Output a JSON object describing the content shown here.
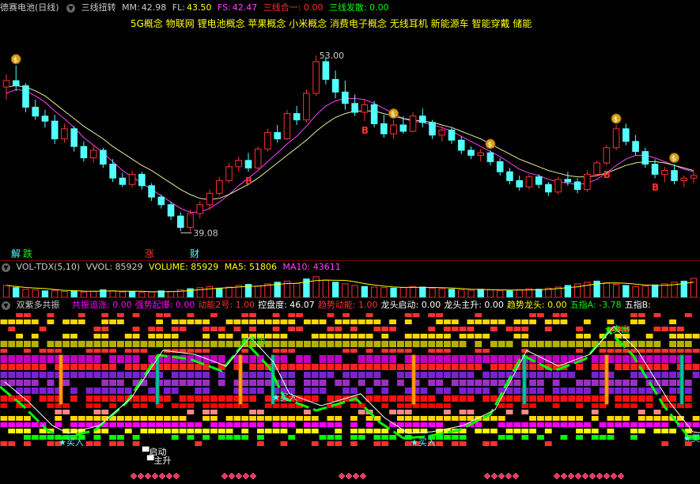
{
  "main_pane": {
    "stock_name": "德赛电池(日线)",
    "indicator": "三线扭转",
    "mm_label": "MM:",
    "mm_value": "42.98",
    "fl_label": "FL:",
    "fl_value": "43.50",
    "fs_label": "FS:",
    "fs_value": "42.47",
    "sanxian_heyi": "三线合一: 0.00",
    "sanxian_fasan": "三线发散: 0.00",
    "concepts": "5G概念 物联网 锂电池概念 苹果概念 小米概念 消费电子概念 无线耳机 新能源车 智能穿戴 储能",
    "low_label": "39.08",
    "high_label": "53.00",
    "b_label": "B",
    "markers": {
      "jie": "解",
      "die": "跌",
      "zhang": "涨",
      "cai": "财"
    }
  },
  "volume_pane": {
    "indicator": "VOL-TDX(5,10)",
    "vvol": "VVOL: 85929",
    "volume": "VOLUME: 85929",
    "ma5": "MA5: 51806",
    "ma10": "MA10: 43611"
  },
  "lower_pane": {
    "indicator": "双紫多共振",
    "items": [
      {
        "text": "共振追涨: 0.00",
        "color": "#ff00ff"
      },
      {
        "text": "强势起爆: 0.00",
        "color": "#ff00ff"
      },
      {
        "text": "动能2号: 1.00",
        "color": "#ff3030"
      },
      {
        "text": "控盘度: 46.07",
        "color": "#ffffff"
      },
      {
        "text": "趋势动能: 1.00",
        "color": "#ff3030"
      },
      {
        "text": "龙头启动: 0.00",
        "color": "#ffffff"
      },
      {
        "text": "龙头主升: 0.00",
        "color": "#ffffff"
      },
      {
        "text": "趋势龙头: 0.00",
        "color": "#ffff00"
      },
      {
        "text": "五指A: -3.78",
        "color": "#00ff00"
      },
      {
        "text": "五指B:",
        "color": "#ffffff"
      }
    ],
    "signals": {
      "sell": "卖出",
      "buy": "买入",
      "qidong": "启动",
      "zhusheng": "主升"
    }
  },
  "colors": {
    "up": "#ff3030",
    "down": "#54ffff",
    "ma_yellow": "#e8e89a",
    "ma_magenta": "#ff40ff",
    "grid_red": "#800000"
  },
  "chart_data": [
    {
      "type": "candlestick",
      "title": "德赛电池(日线)",
      "ylim": [
        38,
        55
      ],
      "candles": [
        [
          50.5,
          51.5,
          49.5,
          51.0
        ],
        [
          51.0,
          52.2,
          50.2,
          50.6
        ],
        [
          50.6,
          50.8,
          48.5,
          48.9
        ],
        [
          48.9,
          49.5,
          47.9,
          48.2
        ],
        [
          48.2,
          48.7,
          47.3,
          47.8
        ],
        [
          47.8,
          48.3,
          46.0,
          46.4
        ],
        [
          46.4,
          47.6,
          46.1,
          47.2
        ],
        [
          47.2,
          47.4,
          45.4,
          45.8
        ],
        [
          45.8,
          46.2,
          44.6,
          44.9
        ],
        [
          44.9,
          45.9,
          44.5,
          45.5
        ],
        [
          45.5,
          45.7,
          44.1,
          44.4
        ],
        [
          44.4,
          44.8,
          43.0,
          43.3
        ],
        [
          43.3,
          43.7,
          42.6,
          42.8
        ],
        [
          42.8,
          43.9,
          42.6,
          43.6
        ],
        [
          43.6,
          43.8,
          42.4,
          42.7
        ],
        [
          42.7,
          42.9,
          41.5,
          41.8
        ],
        [
          41.8,
          42.0,
          40.9,
          41.2
        ],
        [
          41.2,
          41.4,
          40.0,
          40.3
        ],
        [
          40.3,
          40.6,
          39.1,
          39.4
        ],
        [
          39.4,
          40.8,
          39.1,
          40.5
        ],
        [
          40.5,
          41.5,
          40.1,
          41.2
        ],
        [
          41.2,
          42.4,
          40.8,
          42.1
        ],
        [
          42.1,
          43.4,
          41.9,
          43.1
        ],
        [
          43.1,
          44.5,
          42.9,
          44.2
        ],
        [
          44.2,
          45.0,
          43.8,
          44.7
        ],
        [
          44.7,
          45.3,
          43.8,
          44.1
        ],
        [
          44.1,
          45.8,
          44.0,
          45.6
        ],
        [
          45.6,
          47.2,
          45.4,
          46.9
        ],
        [
          46.9,
          47.5,
          46.1,
          46.4
        ],
        [
          46.4,
          48.7,
          46.3,
          48.4
        ],
        [
          48.4,
          49.0,
          47.5,
          47.9
        ],
        [
          47.9,
          50.3,
          47.7,
          50.0
        ],
        [
          50.0,
          53.0,
          49.8,
          52.5
        ],
        [
          52.5,
          52.9,
          50.7,
          51.1
        ],
        [
          51.1,
          51.8,
          49.6,
          50.1
        ],
        [
          50.1,
          51.0,
          48.7,
          49.2
        ],
        [
          49.2,
          49.9,
          48.2,
          48.5
        ],
        [
          48.5,
          49.5,
          47.8,
          49.1
        ],
        [
          49.1,
          49.4,
          47.3,
          47.6
        ],
        [
          47.6,
          48.3,
          46.5,
          46.8
        ],
        [
          46.8,
          47.9,
          46.4,
          47.5
        ],
        [
          47.5,
          48.2,
          46.8,
          47.0
        ],
        [
          47.0,
          48.5,
          46.9,
          48.2
        ],
        [
          48.2,
          48.8,
          47.3,
          47.7
        ],
        [
          47.7,
          47.9,
          46.4,
          46.7
        ],
        [
          46.7,
          47.4,
          46.2,
          47.1
        ],
        [
          47.1,
          47.3,
          46.0,
          46.3
        ],
        [
          46.3,
          46.6,
          45.2,
          45.5
        ],
        [
          45.5,
          45.8,
          44.8,
          45.1
        ],
        [
          45.1,
          45.6,
          44.6,
          45.3
        ],
        [
          45.3,
          45.5,
          44.3,
          44.6
        ],
        [
          44.6,
          44.9,
          43.5,
          43.8
        ],
        [
          43.8,
          44.1,
          42.8,
          43.1
        ],
        [
          43.1,
          43.5,
          42.3,
          42.6
        ],
        [
          42.6,
          43.6,
          42.4,
          43.4
        ],
        [
          43.4,
          43.6,
          42.5,
          42.8
        ],
        [
          42.8,
          43.0,
          41.9,
          42.2
        ],
        [
          42.2,
          43.4,
          42.0,
          43.2
        ],
        [
          43.2,
          43.8,
          42.7,
          43.0
        ],
        [
          43.0,
          43.3,
          42.1,
          42.4
        ],
        [
          42.4,
          43.9,
          42.2,
          43.6
        ],
        [
          43.6,
          44.7,
          43.4,
          44.5
        ],
        [
          44.5,
          45.9,
          44.3,
          45.7
        ],
        [
          45.7,
          47.5,
          45.5,
          47.2
        ],
        [
          47.2,
          47.6,
          45.9,
          46.2
        ],
        [
          46.2,
          46.7,
          45.1,
          45.4
        ],
        [
          45.4,
          45.7,
          44.1,
          44.4
        ],
        [
          44.4,
          44.8,
          43.3,
          43.6
        ],
        [
          43.6,
          44.2,
          43.0,
          43.9
        ],
        [
          43.9,
          44.4,
          42.8,
          43.1
        ],
        [
          43.1,
          43.5,
          42.6,
          43.3
        ],
        [
          43.3,
          43.8,
          42.9,
          43.5
        ]
      ],
      "ma_series": [
        {
          "name": "MM",
          "values": [
            50.0,
            50.3,
            50.2,
            49.8,
            49.3,
            48.6,
            48.0,
            47.3,
            46.5,
            45.9,
            45.3,
            44.6,
            43.9,
            43.4,
            42.9,
            42.4,
            41.9,
            41.4,
            40.9,
            40.6,
            40.6,
            40.9,
            41.4,
            42.0,
            42.7,
            43.3,
            43.9,
            44.6,
            45.3,
            46.0,
            46.6,
            47.4,
            48.3,
            49.0,
            49.4,
            49.6,
            49.6,
            49.5,
            49.2,
            48.8,
            48.4,
            48.0,
            47.8,
            47.7,
            47.5,
            47.3,
            47.0,
            46.6,
            46.2,
            45.8,
            45.4,
            45.0,
            44.5,
            44.0,
            43.7,
            43.5,
            43.2,
            43.0,
            42.9,
            42.8,
            42.9,
            43.2,
            43.7,
            44.3,
            44.8,
            45.1,
            45.1,
            44.9,
            44.6,
            44.3,
            44.0,
            43.8
          ]
        },
        {
          "name": "FL",
          "values": [
            50.5,
            50.6,
            50.5,
            50.2,
            49.8,
            49.2,
            48.6,
            48.0,
            47.4,
            46.9,
            46.4,
            45.8,
            45.3,
            44.8,
            44.3,
            43.9,
            43.4,
            42.9,
            42.4,
            42.0,
            41.7,
            41.6,
            41.7,
            42.0,
            42.4,
            42.8,
            43.3,
            43.9,
            44.5,
            45.1,
            45.7,
            46.3,
            47.0,
            47.6,
            48.1,
            48.4,
            48.6,
            48.6,
            48.6,
            48.4,
            48.2,
            48.0,
            47.9,
            47.8,
            47.7,
            47.5,
            47.3,
            47.0,
            46.7,
            46.4,
            46.0,
            45.6,
            45.2,
            44.8,
            44.5,
            44.2,
            43.9,
            43.7,
            43.5,
            43.4,
            43.4,
            43.5,
            43.7,
            44.0,
            44.3,
            44.5,
            44.6,
            44.6,
            44.5,
            44.3,
            44.1,
            43.9
          ]
        }
      ]
    },
    {
      "type": "bar",
      "title": "VOL-TDX(5,10)",
      "values": [
        22,
        18,
        15,
        14,
        12,
        13,
        11,
        12,
        10,
        11,
        14,
        12,
        10,
        11,
        9,
        10,
        12,
        11,
        14,
        16,
        18,
        20,
        17,
        19,
        22,
        24,
        21,
        25,
        28,
        30,
        26,
        34,
        38,
        32,
        28,
        25,
        22,
        20,
        19,
        18,
        17,
        18,
        20,
        19,
        17,
        16,
        15,
        14,
        13,
        15,
        14,
        13,
        12,
        14,
        16,
        15,
        17,
        19,
        22,
        25,
        28,
        30,
        27,
        24,
        22,
        20,
        21,
        23,
        25,
        28,
        30,
        35
      ]
    }
  ]
}
